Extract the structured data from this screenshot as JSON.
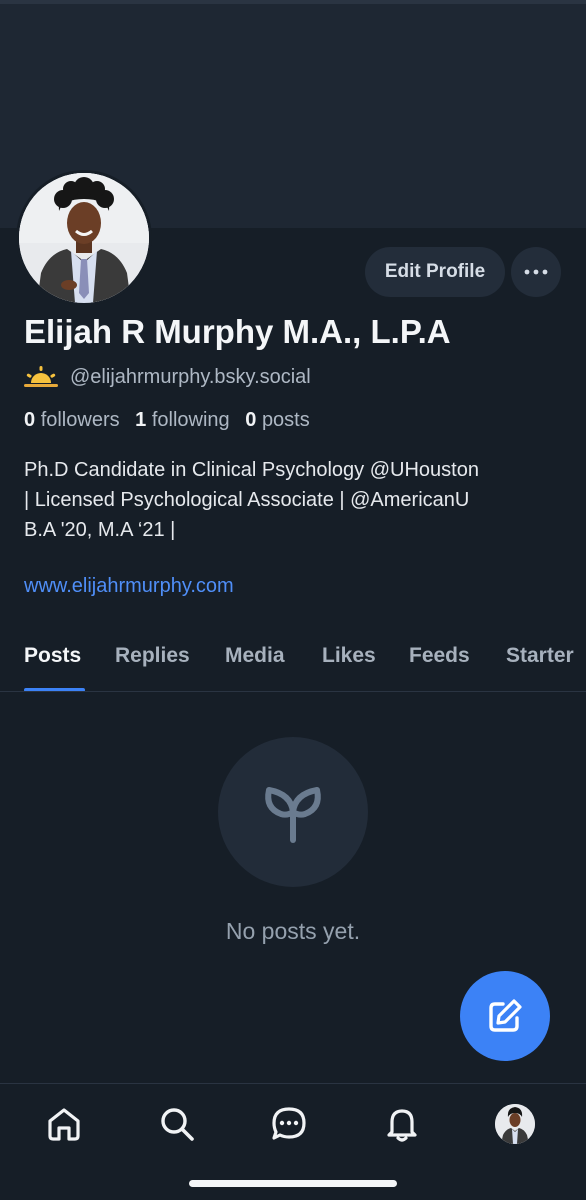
{
  "profile": {
    "display_name": "Elijah R Murphy M.A., L.P.A",
    "handle": "@elijahrmurphy.bsky.social",
    "avatar": "profile-photo",
    "handle_emoji": "sunrise-emoji"
  },
  "actions": {
    "edit_profile_label": "Edit Profile",
    "more_label": "•••"
  },
  "stats": {
    "followers_count": "0",
    "followers_label": "followers",
    "following_count": "1",
    "following_label": "following",
    "posts_count": "0",
    "posts_label": "posts"
  },
  "bio": {
    "line1": "Ph.D Candidate in Clinical Psychology @UHouston",
    "line2": "| Licensed Psychological Associate | @AmericanU",
    "line3": "B.A '20, M.A ‘21 |",
    "link": "www.elijahrmurphy.com"
  },
  "tabs": [
    {
      "label": "Posts",
      "active": true
    },
    {
      "label": "Replies",
      "active": false
    },
    {
      "label": "Media",
      "active": false
    },
    {
      "label": "Likes",
      "active": false
    },
    {
      "label": "Feeds",
      "active": false
    },
    {
      "label": "Starter",
      "active": false
    }
  ],
  "empty_state": {
    "icon": "sprout-icon",
    "message": "No posts yet."
  },
  "fab": {
    "icon": "compose-icon"
  },
  "bottom_nav": [
    {
      "icon": "home-icon"
    },
    {
      "icon": "search-icon"
    },
    {
      "icon": "chat-icon"
    },
    {
      "icon": "bell-icon"
    },
    {
      "icon": "profile-avatar"
    }
  ],
  "colors": {
    "background": "#161e27",
    "banner": "#1e2733",
    "accent": "#3c82f6",
    "link": "#4f8ef7",
    "muted_text": "#aeb8c4"
  }
}
